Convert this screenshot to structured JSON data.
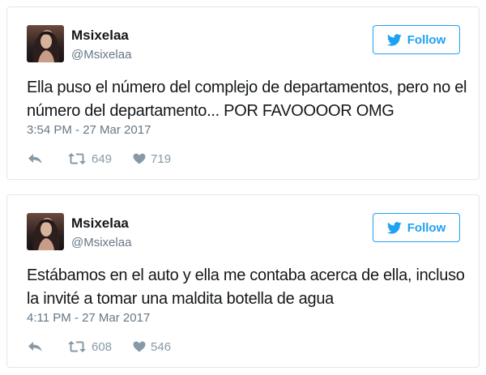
{
  "colors": {
    "accent": "#1da1f2",
    "muted": "#657786",
    "icon": "#8899a6",
    "text": "#14171a",
    "border": "#e1e8ed"
  },
  "icons": {
    "follow": "twitter-bird-icon",
    "reply": "reply-icon",
    "retweet": "retweet-icon",
    "like": "heart-icon"
  },
  "tweets": [
    {
      "name": "Msixelaa",
      "handle": "@Msixelaa",
      "follow_label": "Follow",
      "text": "Ella puso el número del complejo de departamentos, pero no el número del departamento... POR FAVOOOOR OMG",
      "timestamp": "3:54 PM - 27 Mar 2017",
      "retweets": "649",
      "likes": "719"
    },
    {
      "name": "Msixelaa",
      "handle": "@Msixelaa",
      "follow_label": "Follow",
      "text": "Estábamos en el auto y ella me contaba acerca de ella, incluso la invité a tomar una maldita botella de agua",
      "timestamp": "4:11 PM - 27 Mar 2017",
      "retweets": "608",
      "likes": "546"
    }
  ]
}
